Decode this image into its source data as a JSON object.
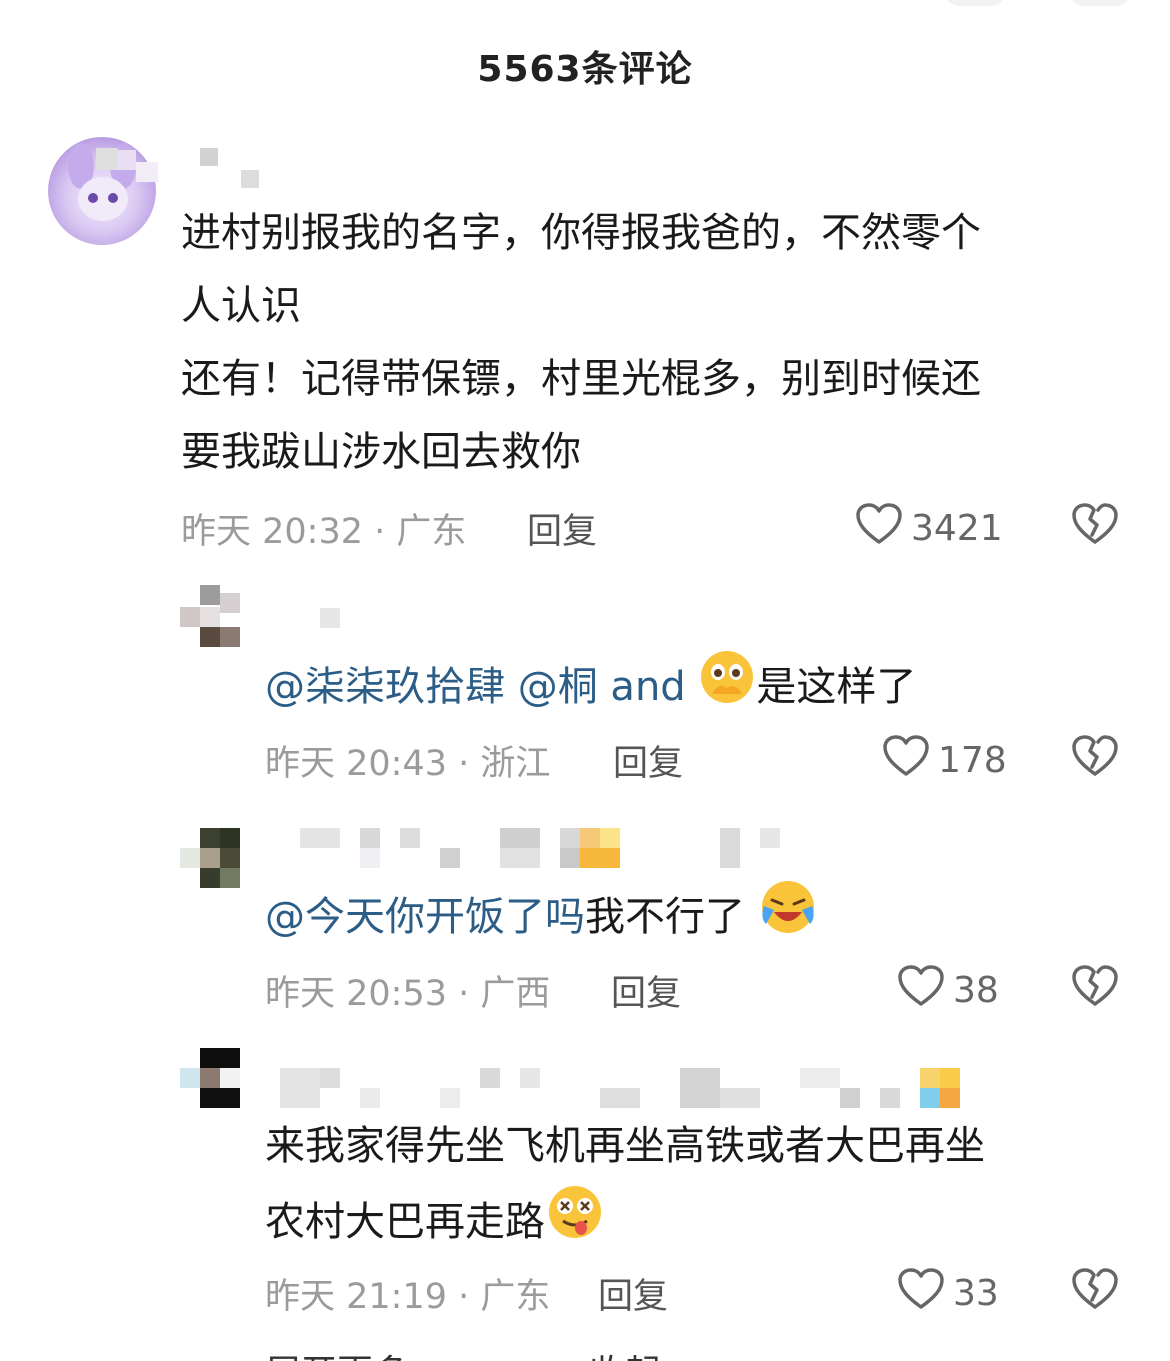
{
  "header": {
    "title": "5563条评论"
  },
  "comments": [
    {
      "lines": [
        "进村别报我的名字，你得报我爸的，不然零个",
        "人认识",
        "还有！记得带保镖，村里光棍多，别到时候还",
        "要我跋山涉水回去救你"
      ],
      "time_location": "昨天 20:32 · 广东",
      "reply_label": "回复",
      "likes": "3421"
    }
  ],
  "replies": [
    {
      "mentions": [
        "@柒柒玖拾肆",
        "@桐 and"
      ],
      "text": "是这样了",
      "emoji_icon": "pleading-face-hands-emoji",
      "time_location": "昨天 20:43 · 浙江",
      "reply_label": "回复",
      "likes": "178"
    },
    {
      "mentions": [
        "@今天你开饭了吗"
      ],
      "text": "我不行了",
      "emoji_icon": "loudly-crying-laughing-emoji",
      "time_location": "昨天 20:53 · 广西",
      "reply_label": "回复",
      "likes": "38"
    },
    {
      "lines": [
        "来我家得先坐飞机再坐高铁或者大巴再坐",
        "农村大巴再走路"
      ],
      "emoji_icon": "dizzy-tongue-face-emoji",
      "time_location": "昨天 21:19 · 广东",
      "reply_label": "回复",
      "likes": "33"
    }
  ],
  "footer": {
    "expand_label": "展开更多",
    "collapse_label": "收起"
  },
  "colors": {
    "mention": "#2b5d86",
    "meta": "#9b9b9b",
    "text": "#1a1a1a"
  },
  "icons": [
    "heart-outline-icon",
    "broken-heart-icon"
  ]
}
